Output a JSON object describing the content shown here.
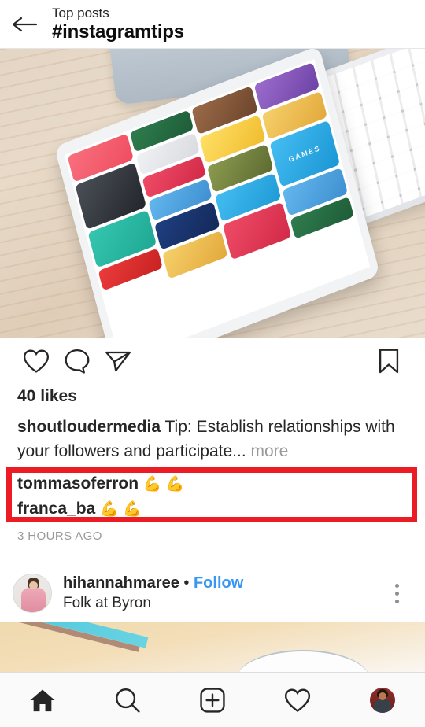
{
  "header": {
    "back_icon": "back-arrow-icon",
    "kicker": "Top posts",
    "title": "#instagramtips"
  },
  "post": {
    "image_alt": "White iPad on wooden desk showing App Store next to keyboard",
    "actions": {
      "like_icon": "heart-icon",
      "comment_icon": "comment-bubble-icon",
      "share_icon": "send-paper-plane-icon",
      "save_icon": "bookmark-icon"
    },
    "likes": "40 likes",
    "caption": {
      "username": "shoutloudermedia",
      "text": "Tip: Establish relationships with your followers and participate...",
      "more_label": "more"
    },
    "comments": [
      {
        "username": "tommasoferron",
        "text": "💪 💪"
      },
      {
        "username": "franca_ba",
        "text": "💪 💪"
      }
    ],
    "timestamp": "3 HOURS AGO"
  },
  "annotation": {
    "shape": "red-rectangle-highlight",
    "color": "#ec1c24"
  },
  "next_post": {
    "avatar_alt": "profile photo of woman in pink dress",
    "username": "hihannahmaree",
    "separator": "•",
    "follow_label": "Follow",
    "location": "Folk at Byron",
    "menu_icon": "more-options-icon"
  },
  "bottom_nav": {
    "items": [
      {
        "name": "home",
        "icon": "home-icon",
        "active": true
      },
      {
        "name": "search",
        "icon": "search-icon",
        "active": false
      },
      {
        "name": "add",
        "icon": "add-post-icon",
        "active": false
      },
      {
        "name": "activity",
        "icon": "heart-icon",
        "active": false
      },
      {
        "name": "profile",
        "icon": "profile-avatar-icon",
        "active": false
      }
    ]
  },
  "colors": {
    "accent_blue": "#3897f0",
    "annotation_red": "#ec1c24",
    "text_primary": "#262626",
    "text_secondary": "#999999"
  }
}
